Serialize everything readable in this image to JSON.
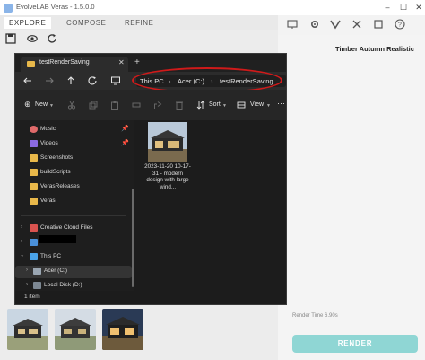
{
  "veras": {
    "title": "EvolveLAB Veras - 1.5.0.0",
    "tabs": [
      {
        "label": "EXPLORE"
      },
      {
        "label": "COMPOSE"
      },
      {
        "label": "REFINE"
      }
    ],
    "style_title": "Timber Autumn Realistic",
    "render_time": "Render Time 6.90s",
    "render_button": "RENDER"
  },
  "explorer": {
    "tab_title": "testRenderSaving",
    "breadcrumb": [
      "This PC",
      "Acer (C:)",
      "testRenderSaving"
    ],
    "commands": {
      "new_label": "New",
      "sort_label": "Sort",
      "view_label": "View",
      "more_label": "···"
    },
    "quick_access": [
      {
        "label": "Music",
        "icon": "music-folder-icon",
        "color": "#e06a6a"
      },
      {
        "label": "Videos",
        "icon": "videos-folder-icon",
        "color": "#8b6ae0"
      },
      {
        "label": "Screenshots",
        "icon": "folder-icon",
        "color": "#e8b84a"
      },
      {
        "label": "buildScripts",
        "icon": "folder-icon",
        "color": "#e8b84a"
      },
      {
        "label": "VerasReleases",
        "icon": "folder-icon",
        "color": "#e8b84a"
      },
      {
        "label": "Veras",
        "icon": "folder-icon",
        "color": "#e8b84a"
      }
    ],
    "tree": {
      "creative_cloud": "Creative Cloud Files",
      "this_pc": "This PC",
      "acer": "Acer (C:)",
      "local_disk": "Local Disk (D:)"
    },
    "file": {
      "name": "2023-11-20 10-17-31 - modern design with large wind..."
    },
    "status": "1 item"
  }
}
